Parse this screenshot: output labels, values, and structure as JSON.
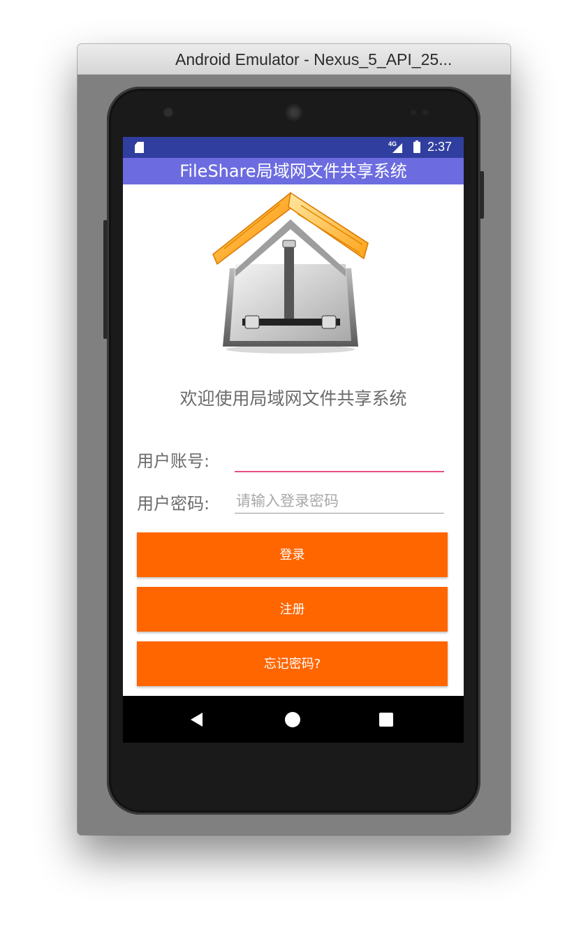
{
  "window": {
    "title": "Android Emulator - Nexus_5_API_25..."
  },
  "statusbar": {
    "network": "4G",
    "time": "2:37",
    "icons": [
      "sd-card-icon",
      "signal-icon",
      "battery-icon"
    ]
  },
  "app": {
    "title": "FileShare局域网文件共享系统",
    "welcome": "欢迎使用局域网文件共享系统",
    "logo_icon": "house-logo-icon"
  },
  "form": {
    "username_label": "用户账号:",
    "username_value": "",
    "username_placeholder": "",
    "password_label": "用户密码:",
    "password_value": "",
    "password_placeholder": "请输入登录密码"
  },
  "buttons": {
    "login": "登录",
    "register": "注册",
    "forgot": "忘记密码?"
  },
  "navbar": {
    "icons": [
      "back-icon",
      "home-icon",
      "recents-icon"
    ]
  },
  "colors": {
    "status_bar": "#303f9f",
    "app_bar": "#6c6ce0",
    "button": "#ff6600",
    "focused_underline": "#e94d85"
  }
}
